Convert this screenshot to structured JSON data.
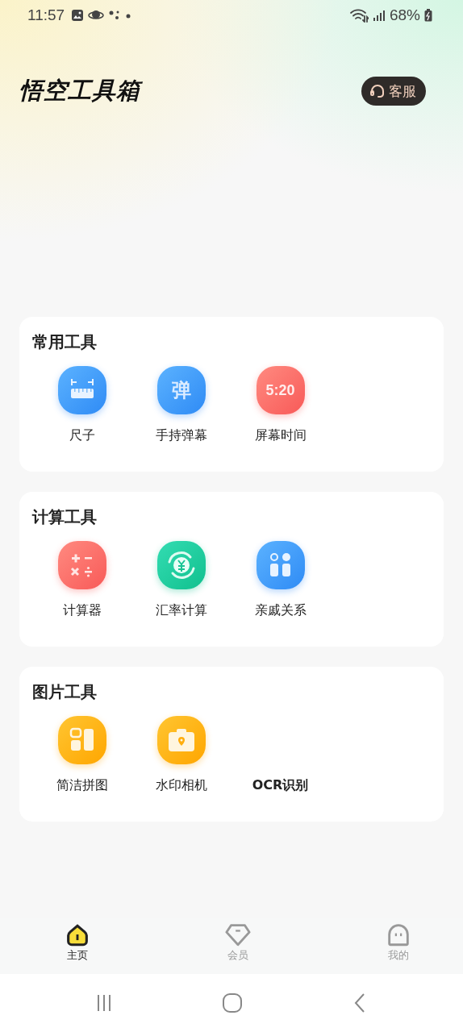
{
  "status_bar": {
    "time": "11:57",
    "battery": "68%"
  },
  "header": {
    "title": "悟空工具箱",
    "service_button": "客服"
  },
  "sections": [
    {
      "title": "常用工具",
      "tools": [
        {
          "label": "尺子",
          "kind": "ruler"
        },
        {
          "label": "手持弹幕",
          "kind": "glyph-blue",
          "icon_text": "弹"
        },
        {
          "label": "屏幕时间",
          "kind": "glyph-red",
          "icon_text": "5:20"
        }
      ]
    },
    {
      "title": "计算工具",
      "tools": [
        {
          "label": "计算器",
          "kind": "calculator"
        },
        {
          "label": "汇率计算",
          "kind": "exchange"
        },
        {
          "label": "亲戚关系",
          "kind": "family"
        }
      ]
    },
    {
      "title": "图片工具",
      "tools": [
        {
          "label": "简洁拼图",
          "kind": "collage"
        },
        {
          "label": "水印相机",
          "kind": "camera"
        },
        {
          "label": "OCR识别",
          "kind": "none"
        }
      ]
    }
  ],
  "bottom_nav": [
    {
      "label": "主页",
      "kind": "home",
      "selected": true
    },
    {
      "label": "会员",
      "kind": "gem",
      "selected": false
    },
    {
      "label": "我的",
      "kind": "face",
      "selected": false
    }
  ]
}
